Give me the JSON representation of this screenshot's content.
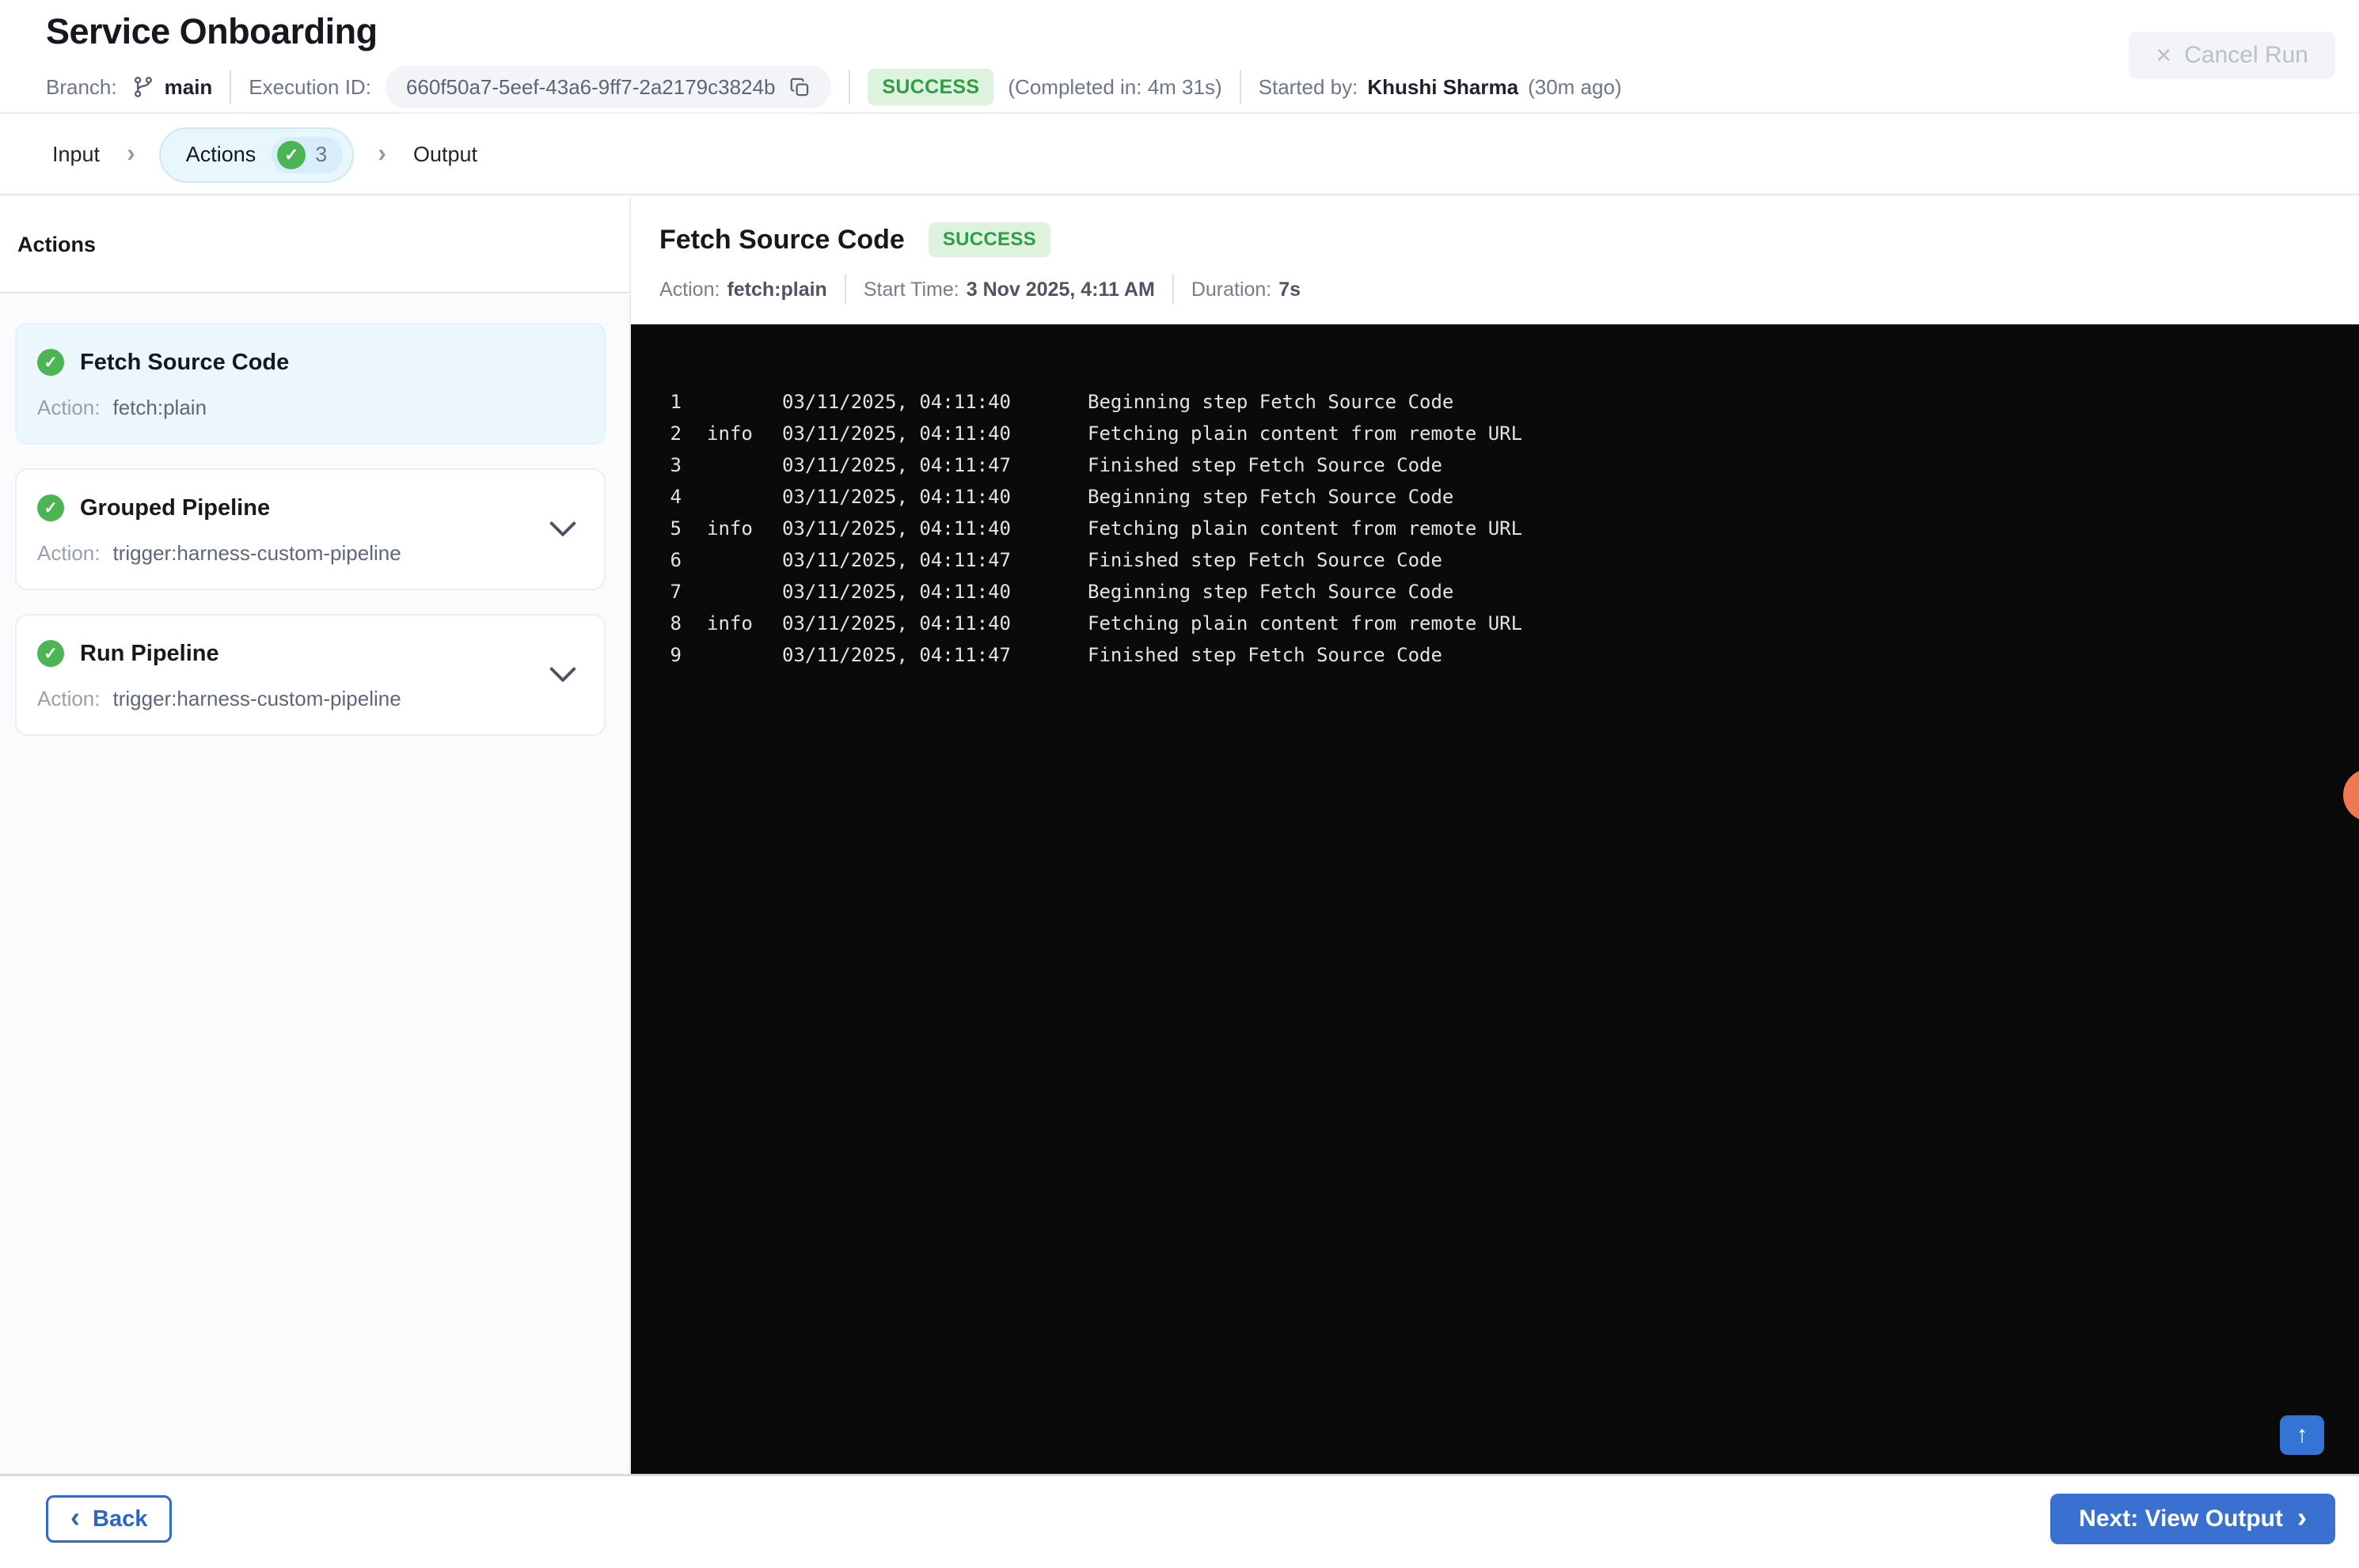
{
  "header": {
    "title": "Service Onboarding",
    "branch_label": "Branch:",
    "branch_value": "main",
    "execution_id_label": "Execution ID:",
    "execution_id": "660f50a7-5eef-43a6-9ff7-2a2179c3824b",
    "status": "SUCCESS",
    "completed_in": "(Completed in: 4m 31s)",
    "started_by_label": "Started by:",
    "started_by": "Khushi Sharma",
    "started_ago": "(30m ago)",
    "cancel_label": "Cancel Run"
  },
  "tabs": {
    "input": "Input",
    "actions": "Actions",
    "actions_count": "3",
    "output": "Output"
  },
  "sidebar": {
    "heading": "Actions",
    "items": [
      {
        "title": "Fetch Source Code",
        "action_label": "Action:",
        "action_value": "fetch:plain"
      },
      {
        "title": "Grouped Pipeline",
        "action_label": "Action:",
        "action_value": "trigger:harness-custom-pipeline"
      },
      {
        "title": "Run Pipeline",
        "action_label": "Action:",
        "action_value": "trigger:harness-custom-pipeline"
      }
    ]
  },
  "detail": {
    "title": "Fetch Source Code",
    "status": "SUCCESS",
    "action_label": "Action:",
    "action_value": "fetch:plain",
    "start_label": "Start Time:",
    "start_value": "3 Nov 2025, 4:11 AM",
    "duration_label": "Duration:",
    "duration_value": "7s"
  },
  "terminal": {
    "lines": [
      {
        "num": "1",
        "tag": "",
        "time": "03/11/2025, 04:11:40",
        "msg": "Beginning step Fetch Source Code"
      },
      {
        "num": "2",
        "tag": "info",
        "time": "03/11/2025, 04:11:40",
        "msg": "Fetching plain content from remote URL"
      },
      {
        "num": "3",
        "tag": "",
        "time": "03/11/2025, 04:11:47",
        "msg": "Finished step Fetch Source Code"
      },
      {
        "num": "4",
        "tag": "",
        "time": "03/11/2025, 04:11:40",
        "msg": "Beginning step Fetch Source Code"
      },
      {
        "num": "5",
        "tag": "info",
        "time": "03/11/2025, 04:11:40",
        "msg": "Fetching plain content from remote URL"
      },
      {
        "num": "6",
        "tag": "",
        "time": "03/11/2025, 04:11:47",
        "msg": "Finished step Fetch Source Code"
      },
      {
        "num": "7",
        "tag": "",
        "time": "03/11/2025, 04:11:40",
        "msg": "Beginning step Fetch Source Code"
      },
      {
        "num": "8",
        "tag": "info",
        "time": "03/11/2025, 04:11:40",
        "msg": "Fetching plain content from remote URL"
      },
      {
        "num": "9",
        "tag": "",
        "time": "03/11/2025, 04:11:47",
        "msg": "Finished step Fetch Source Code"
      }
    ]
  },
  "footer": {
    "back_label": "Back",
    "next_label": "Next: View Output"
  },
  "icons": {
    "chevron_right_sep": "›",
    "chevron_left": "‹",
    "chevron_right": "›",
    "close": "×",
    "check": "✓",
    "arrow_up": "↑"
  },
  "colors": {
    "accent_blue": "#3a71d0",
    "success_text": "#2f9e44",
    "success_bg": "#ddf3de",
    "check_green": "#4cb553",
    "active_tint": "#e8f6fd",
    "terminal_bg": "#0a0a0b",
    "orange_widget": "#ee7950"
  }
}
